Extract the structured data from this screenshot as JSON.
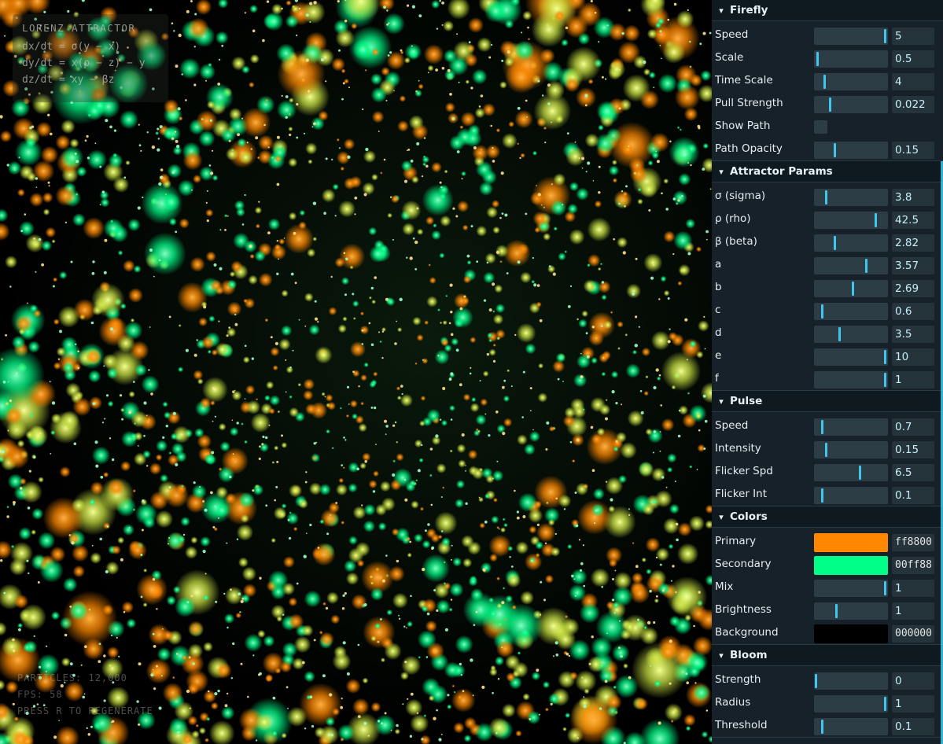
{
  "overlay": {
    "title": "LORENZ ATTRACTOR",
    "equations": [
      "dx/dt = σ(y − x)",
      "dy/dt = x(ρ − z) − y",
      "dz/dt = xy − βz"
    ],
    "stats": [
      "PARTICLES: 12,000",
      "FPS: 58",
      "PRESS R TO REGENERATE"
    ]
  },
  "gui": {
    "folders": [
      {
        "title": "Firefly",
        "rows": [
          {
            "type": "slider",
            "label": "Speed",
            "value": "5",
            "level": 0.98
          },
          {
            "type": "slider",
            "label": "Scale",
            "value": "0.5",
            "level": 0.03
          },
          {
            "type": "slider",
            "label": "Time Scale",
            "value": "4",
            "level": 0.13
          },
          {
            "type": "slider",
            "label": "Pull Strength",
            "value": "0.022",
            "level": 0.21
          },
          {
            "type": "checkbox",
            "label": "Show Path",
            "checked": false
          },
          {
            "type": "slider",
            "label": "Path Opacity",
            "value": "0.15",
            "level": 0.27
          }
        ]
      },
      {
        "title": "Attractor Params",
        "rows": [
          {
            "type": "slider",
            "label": "σ (sigma)",
            "value": "3.8",
            "level": 0.15
          },
          {
            "type": "slider",
            "label": "ρ (rho)",
            "value": "42.5",
            "level": 0.85
          },
          {
            "type": "slider",
            "label": "β (beta)",
            "value": "2.82",
            "level": 0.27
          },
          {
            "type": "slider",
            "label": "a",
            "value": "3.57",
            "level": 0.71
          },
          {
            "type": "slider",
            "label": "b",
            "value": "2.69",
            "level": 0.53
          },
          {
            "type": "slider",
            "label": "c",
            "value": "0.6",
            "level": 0.1
          },
          {
            "type": "slider",
            "label": "d",
            "value": "3.5",
            "level": 0.34
          },
          {
            "type": "slider",
            "label": "e",
            "value": "10",
            "level": 0.98
          },
          {
            "type": "slider",
            "label": "f",
            "value": "1",
            "level": 0.98
          }
        ]
      },
      {
        "title": "Pulse",
        "rows": [
          {
            "type": "slider",
            "label": "Speed",
            "value": "0.7",
            "level": 0.1
          },
          {
            "type": "slider",
            "label": "Intensity",
            "value": "0.15",
            "level": 0.15
          },
          {
            "type": "slider",
            "label": "Flicker Spd",
            "value": "6.5",
            "level": 0.63
          },
          {
            "type": "slider",
            "label": "Flicker Int",
            "value": "0.1",
            "level": 0.1
          }
        ]
      },
      {
        "title": "Colors",
        "rows": [
          {
            "type": "color",
            "label": "Primary",
            "value": "ff8800",
            "color": "#ff8800"
          },
          {
            "type": "color",
            "label": "Secondary",
            "value": "00ff88",
            "color": "#00ff88"
          },
          {
            "type": "slider",
            "label": "Mix",
            "value": "1",
            "level": 0.98
          },
          {
            "type": "slider",
            "label": "Brightness",
            "value": "1",
            "level": 0.3
          },
          {
            "type": "color",
            "label": "Background",
            "value": "000000",
            "color": "#000000"
          }
        ]
      },
      {
        "title": "Bloom",
        "rows": [
          {
            "type": "slider",
            "label": "Strength",
            "value": "0",
            "level": 0.01
          },
          {
            "type": "slider",
            "label": "Radius",
            "value": "1",
            "level": 0.98
          },
          {
            "type": "slider",
            "label": "Threshold",
            "value": "0.1",
            "level": 0.1
          }
        ]
      }
    ]
  },
  "colors": {
    "accent": "#3fc7ee",
    "particle_primary": "#ff8800",
    "particle_secondary": "#00ff88"
  }
}
